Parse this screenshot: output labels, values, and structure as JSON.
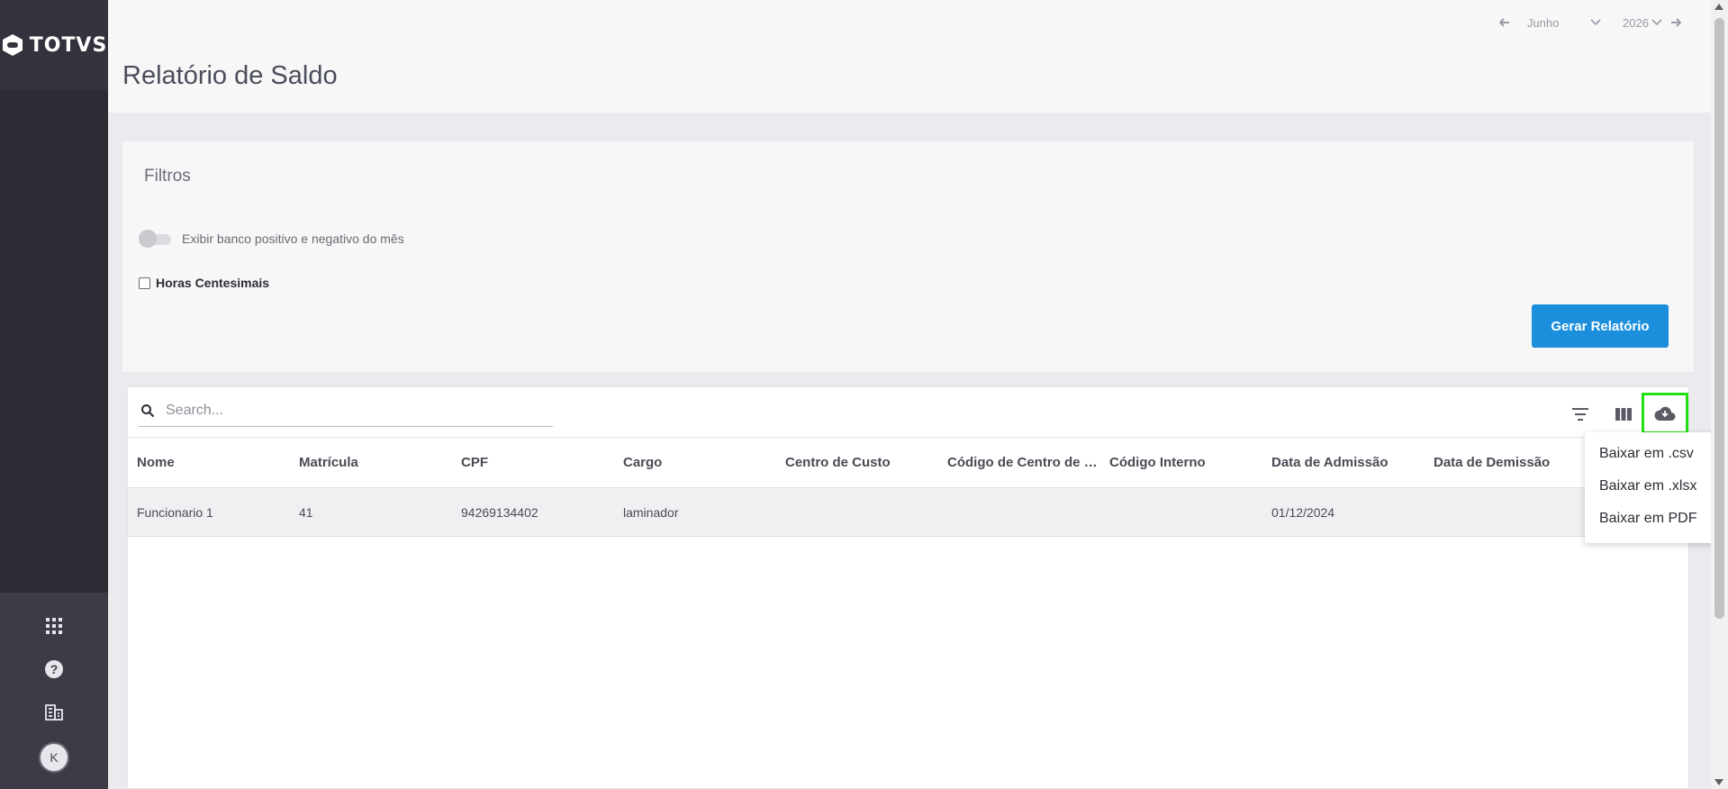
{
  "brand": {
    "logo_text": "TOTVS"
  },
  "header": {
    "title": "Relatório de Saldo",
    "month": "Junho",
    "year": "2026"
  },
  "filters": {
    "title": "Filtros",
    "toggle_label": "Exibir banco positivo e negativo do mês",
    "checkbox_label": "Horas Centesimais",
    "generate_label": "Gerar Relatório"
  },
  "table": {
    "search_placeholder": "Search...",
    "columns": [
      "Nome",
      "Matrícula",
      "CPF",
      "Cargo",
      "Centro de Custo",
      "Código de Centro de Custo",
      "Código Interno",
      "Data de Admissão",
      "Data de Demissão"
    ],
    "rows": [
      [
        "Funcionario 1",
        "41",
        "94269134402",
        "laminador",
        "",
        "",
        "",
        "01/12/2024",
        ""
      ]
    ]
  },
  "download_menu": {
    "items": [
      "Baixar em .csv",
      "Baixar em .xlsx",
      "Baixar em PDF"
    ]
  },
  "user": {
    "initial": "K"
  },
  "colors": {
    "primary": "#1b8fdc",
    "sidebar": "#2c2c35",
    "highlight": "#20e00e"
  }
}
